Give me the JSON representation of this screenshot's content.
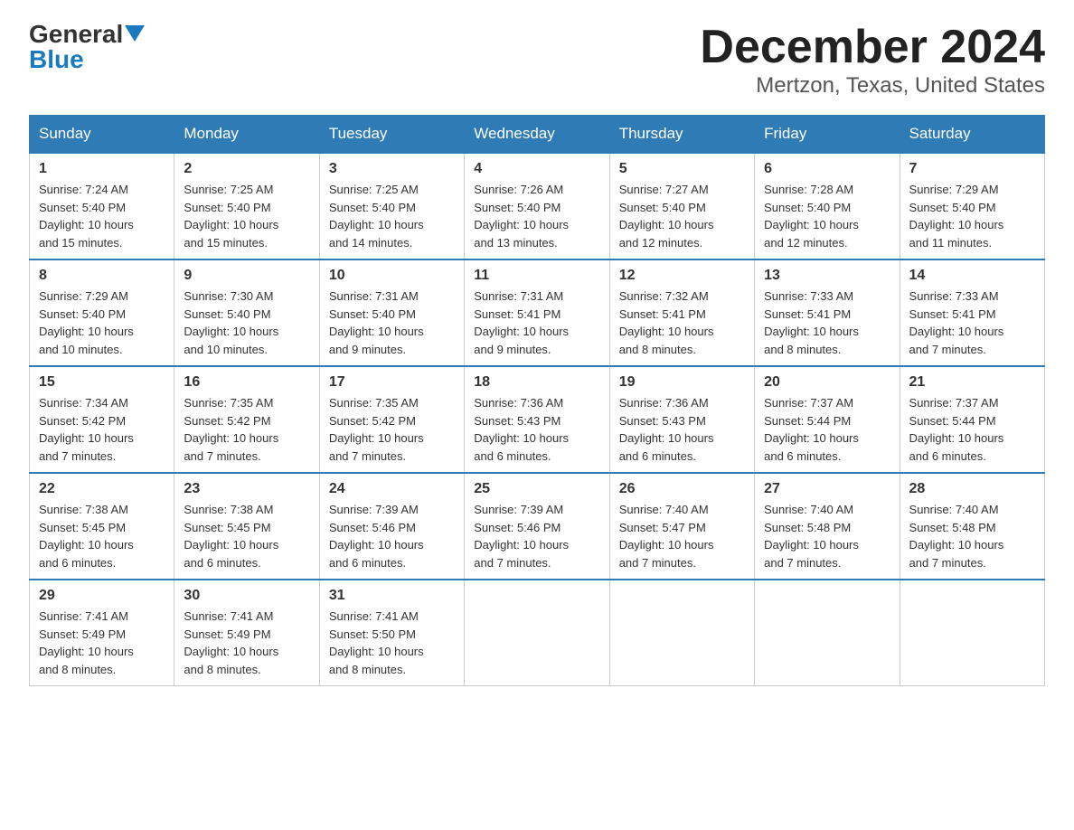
{
  "logo": {
    "general": "General",
    "blue": "Blue",
    "triangle": "▲"
  },
  "title": "December 2024",
  "subtitle": "Mertzon, Texas, United States",
  "days_of_week": [
    "Sunday",
    "Monday",
    "Tuesday",
    "Wednesday",
    "Thursday",
    "Friday",
    "Saturday"
  ],
  "weeks": [
    [
      {
        "day": "1",
        "sunrise": "7:24 AM",
        "sunset": "5:40 PM",
        "daylight": "10 hours and 15 minutes."
      },
      {
        "day": "2",
        "sunrise": "7:25 AM",
        "sunset": "5:40 PM",
        "daylight": "10 hours and 15 minutes."
      },
      {
        "day": "3",
        "sunrise": "7:25 AM",
        "sunset": "5:40 PM",
        "daylight": "10 hours and 14 minutes."
      },
      {
        "day": "4",
        "sunrise": "7:26 AM",
        "sunset": "5:40 PM",
        "daylight": "10 hours and 13 minutes."
      },
      {
        "day": "5",
        "sunrise": "7:27 AM",
        "sunset": "5:40 PM",
        "daylight": "10 hours and 12 minutes."
      },
      {
        "day": "6",
        "sunrise": "7:28 AM",
        "sunset": "5:40 PM",
        "daylight": "10 hours and 12 minutes."
      },
      {
        "day": "7",
        "sunrise": "7:29 AM",
        "sunset": "5:40 PM",
        "daylight": "10 hours and 11 minutes."
      }
    ],
    [
      {
        "day": "8",
        "sunrise": "7:29 AM",
        "sunset": "5:40 PM",
        "daylight": "10 hours and 10 minutes."
      },
      {
        "day": "9",
        "sunrise": "7:30 AM",
        "sunset": "5:40 PM",
        "daylight": "10 hours and 10 minutes."
      },
      {
        "day": "10",
        "sunrise": "7:31 AM",
        "sunset": "5:40 PM",
        "daylight": "10 hours and 9 minutes."
      },
      {
        "day": "11",
        "sunrise": "7:31 AM",
        "sunset": "5:41 PM",
        "daylight": "10 hours and 9 minutes."
      },
      {
        "day": "12",
        "sunrise": "7:32 AM",
        "sunset": "5:41 PM",
        "daylight": "10 hours and 8 minutes."
      },
      {
        "day": "13",
        "sunrise": "7:33 AM",
        "sunset": "5:41 PM",
        "daylight": "10 hours and 8 minutes."
      },
      {
        "day": "14",
        "sunrise": "7:33 AM",
        "sunset": "5:41 PM",
        "daylight": "10 hours and 7 minutes."
      }
    ],
    [
      {
        "day": "15",
        "sunrise": "7:34 AM",
        "sunset": "5:42 PM",
        "daylight": "10 hours and 7 minutes."
      },
      {
        "day": "16",
        "sunrise": "7:35 AM",
        "sunset": "5:42 PM",
        "daylight": "10 hours and 7 minutes."
      },
      {
        "day": "17",
        "sunrise": "7:35 AM",
        "sunset": "5:42 PM",
        "daylight": "10 hours and 7 minutes."
      },
      {
        "day": "18",
        "sunrise": "7:36 AM",
        "sunset": "5:43 PM",
        "daylight": "10 hours and 6 minutes."
      },
      {
        "day": "19",
        "sunrise": "7:36 AM",
        "sunset": "5:43 PM",
        "daylight": "10 hours and 6 minutes."
      },
      {
        "day": "20",
        "sunrise": "7:37 AM",
        "sunset": "5:44 PM",
        "daylight": "10 hours and 6 minutes."
      },
      {
        "day": "21",
        "sunrise": "7:37 AM",
        "sunset": "5:44 PM",
        "daylight": "10 hours and 6 minutes."
      }
    ],
    [
      {
        "day": "22",
        "sunrise": "7:38 AM",
        "sunset": "5:45 PM",
        "daylight": "10 hours and 6 minutes."
      },
      {
        "day": "23",
        "sunrise": "7:38 AM",
        "sunset": "5:45 PM",
        "daylight": "10 hours and 6 minutes."
      },
      {
        "day": "24",
        "sunrise": "7:39 AM",
        "sunset": "5:46 PM",
        "daylight": "10 hours and 6 minutes."
      },
      {
        "day": "25",
        "sunrise": "7:39 AM",
        "sunset": "5:46 PM",
        "daylight": "10 hours and 7 minutes."
      },
      {
        "day": "26",
        "sunrise": "7:40 AM",
        "sunset": "5:47 PM",
        "daylight": "10 hours and 7 minutes."
      },
      {
        "day": "27",
        "sunrise": "7:40 AM",
        "sunset": "5:48 PM",
        "daylight": "10 hours and 7 minutes."
      },
      {
        "day": "28",
        "sunrise": "7:40 AM",
        "sunset": "5:48 PM",
        "daylight": "10 hours and 7 minutes."
      }
    ],
    [
      {
        "day": "29",
        "sunrise": "7:41 AM",
        "sunset": "5:49 PM",
        "daylight": "10 hours and 8 minutes."
      },
      {
        "day": "30",
        "sunrise": "7:41 AM",
        "sunset": "5:49 PM",
        "daylight": "10 hours and 8 minutes."
      },
      {
        "day": "31",
        "sunrise": "7:41 AM",
        "sunset": "5:50 PM",
        "daylight": "10 hours and 8 minutes."
      },
      null,
      null,
      null,
      null
    ]
  ],
  "labels": {
    "sunrise": "Sunrise:",
    "sunset": "Sunset:",
    "daylight": "Daylight:"
  }
}
